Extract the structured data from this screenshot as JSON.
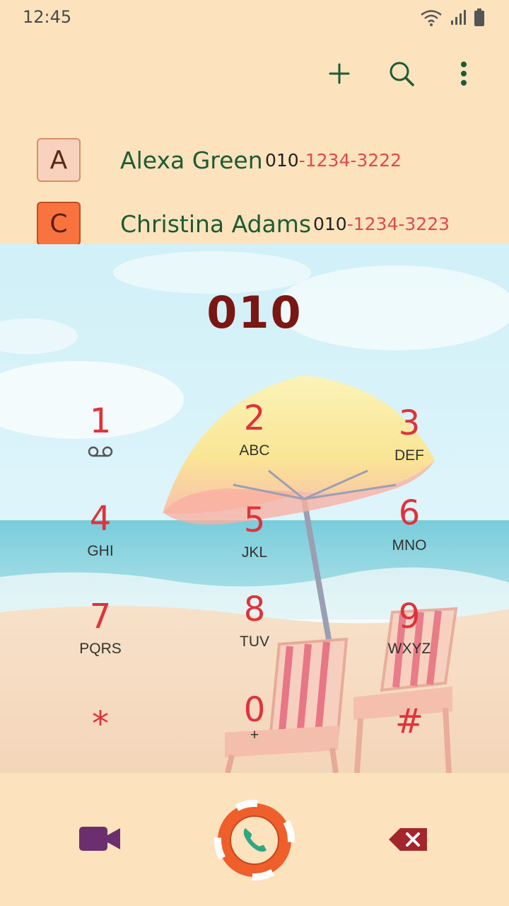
{
  "status": {
    "time": "12:45"
  },
  "toolbar": {
    "add_icon": "plus-icon",
    "search_icon": "search-icon",
    "more_icon": "more-vertical-icon"
  },
  "contacts": [
    {
      "letter": "A",
      "name": "Alexa Green",
      "number_prefix": "010",
      "number_rest": "-1234-3222",
      "letter_bg": "#f9d2bd"
    },
    {
      "letter": "C",
      "name": "Christina Adams",
      "number_prefix": "010",
      "number_rest": "-1234-3223",
      "letter_bg": "#f8733d"
    }
  ],
  "dialer": {
    "display": "010",
    "keys": [
      {
        "digit": "1",
        "letters": ""
      },
      {
        "digit": "2",
        "letters": "ABC"
      },
      {
        "digit": "3",
        "letters": "DEF"
      },
      {
        "digit": "4",
        "letters": "GHI"
      },
      {
        "digit": "5",
        "letters": "JKL"
      },
      {
        "digit": "6",
        "letters": "MNO"
      },
      {
        "digit": "7",
        "letters": "PQRS"
      },
      {
        "digit": "8",
        "letters": "TUV"
      },
      {
        "digit": "9",
        "letters": "WXYZ"
      },
      {
        "digit": "*",
        "letters": ""
      },
      {
        "digit": "0",
        "letters": "+"
      },
      {
        "digit": "#",
        "letters": ""
      }
    ]
  },
  "bottom": {
    "video_icon": "video-call-icon",
    "call_icon": "phone-call-icon",
    "backspace_icon": "backspace-icon"
  },
  "colors": {
    "background": "#fde3bd",
    "accent_green": "#1e5a34",
    "digit_red": "#e0323a",
    "display_red": "#7a1614"
  }
}
